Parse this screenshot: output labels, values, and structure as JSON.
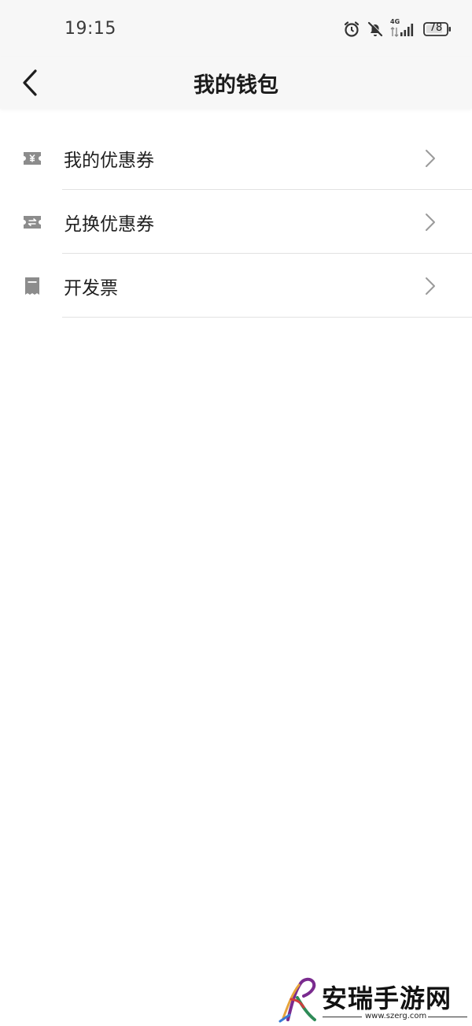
{
  "status_bar": {
    "time": "19:15",
    "network": "4G",
    "battery": "78",
    "icons": [
      "alarm-icon",
      "bell-muted-icon",
      "signal-icon",
      "battery-icon"
    ]
  },
  "header": {
    "title": "我的钱包",
    "back_icon": "chevron-left-icon"
  },
  "menu": {
    "items": [
      {
        "label": "我的优惠券",
        "icon": "coupon-yen-icon"
      },
      {
        "label": "兑换优惠券",
        "icon": "coupon-exchange-icon"
      },
      {
        "label": "开发票",
        "icon": "invoice-icon"
      }
    ]
  },
  "watermark": {
    "name": "安瑞手游网",
    "url": "www.szerg.com"
  },
  "colors": {
    "background": "#ffffff",
    "header_background": "#f7f7f7",
    "icon_gray": "#8c8c8c",
    "divider": "#e2e2e2",
    "text": "#1f1f1f"
  }
}
